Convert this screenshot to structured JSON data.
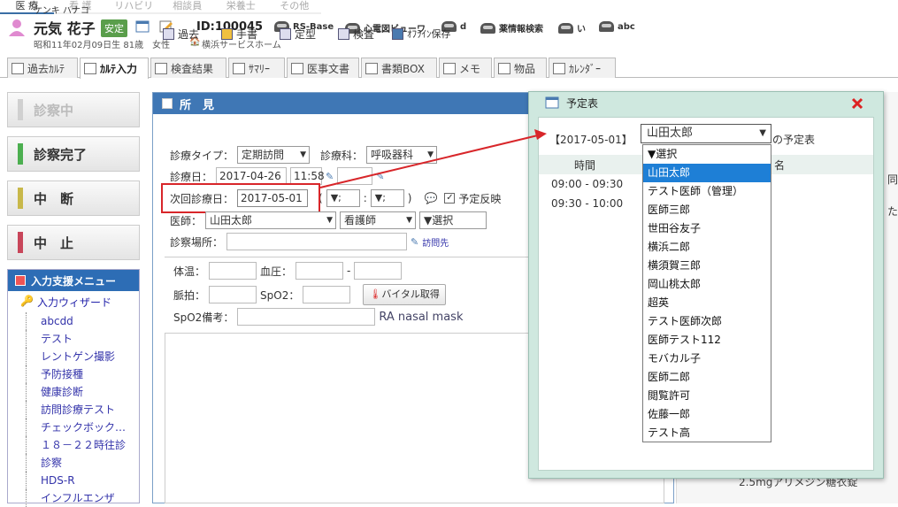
{
  "patient": {
    "kana": "ケンキ ハナコ",
    "name": "元気 花子",
    "status_badge": "安定",
    "id": "ID:100045",
    "birth_info": "昭和11年02月09日生 81歳　女性",
    "facility": "横浜サービスホーム"
  },
  "quick_links": [
    "RS-Base",
    "心電図ビューワ",
    "d",
    "薬情報検索",
    "い",
    "abc"
  ],
  "roles": [
    "医 療",
    "看 護",
    "リハビリ",
    "相談員",
    "栄養士",
    "その他"
  ],
  "tabs": [
    "過去ｶﾙﾃ",
    "ｶﾙﾃ入力",
    "検査結果",
    "ｻﾏﾘｰ",
    "医事文書",
    "書類BOX",
    "メモ",
    "物品",
    "ｶﾚﾝﾀﾞｰ"
  ],
  "sidebar": {
    "buttons": [
      {
        "label": "診察中",
        "color": "#c9c9c9"
      },
      {
        "label": "診察完了",
        "color": "#4caf50"
      },
      {
        "label": "中　断",
        "color": "#c8b84a"
      },
      {
        "label": "中　止",
        "color": "#c8465a"
      }
    ],
    "assist_title": "入力支援メニュー",
    "wizard": "入力ウィザード",
    "items": [
      "abcdd",
      "テスト",
      "レントゲン撮影",
      "予防接種",
      "健康診断",
      "訪問診療テスト",
      "チェックボック…",
      "１８－２２時往診",
      "診察",
      "HDS-R",
      "インフルエンザ"
    ]
  },
  "findings": {
    "title": "所　見",
    "toolbar": [
      "過去",
      "手書",
      "定型",
      "検査",
      "ｵﾌﾗｲﾝ保存"
    ],
    "care_type_label": "診療タイプ：",
    "care_type_value": "定期訪問",
    "dept_label": "診療科：",
    "dept_value": "呼吸器科",
    "visit_date_label": "診療日：",
    "visit_date_value": "2017-04-26",
    "visit_time_value": "11:58",
    "next_date_label": "次回診療日：",
    "next_date_value": "2017-05-01",
    "paren_open": "(",
    "hour_select": "▼;",
    "colon": ":",
    "minute_select": "▼;",
    "paren_close": ")",
    "schedule_reflect": "予定反映",
    "doctor_label": "医師：",
    "doctor_value": "山田太郎",
    "nurse_value": "看護師",
    "other_select": "▼選択",
    "place_label": "診察場所：",
    "visit_link": "訪問先",
    "temp_label": "体温：",
    "bp_label": "血圧：",
    "bp_sep": "-",
    "pulse_label": "脈拍：",
    "spo2_label": "SpO2：",
    "vital_button": "バイタル取得",
    "spo2_note_label": "SpO2備考：",
    "spo2_note_value": "RA nasal mask"
  },
  "schedule_dialog": {
    "title": "予定表",
    "date_bracket": "【2017-05-01】",
    "selected_doctor": "山田太郎",
    "suffix": "の予定表",
    "time_header": "時間",
    "name_header_fragment": "名",
    "slots": [
      "09:00 - 09:30",
      "09:30 - 10:00"
    ],
    "options": [
      "▼選択",
      "山田太郎",
      "テスト医師（管理）",
      "医師三郎",
      "世田谷友子",
      "横浜二郎",
      "横須賀三郎",
      "岡山桃太郎",
      "超英",
      "テスト医師次郎",
      "医師テスト112",
      "モバカル子",
      "医師二郎",
      "閲覧許可",
      "佐藤一郎",
      "テスト高"
    ],
    "highlighted_index": 1
  },
  "background_fragments": {
    "right_text_1": "同",
    "right_text_2": "た",
    "bottom_text": "2.5mgアリメジン糖衣錠"
  },
  "colors": {
    "header_blue": "#3f77b5",
    "dialog_green": "#cfe8df",
    "highlight": "#1e7fd6",
    "annotation_red": "#d8262a"
  }
}
